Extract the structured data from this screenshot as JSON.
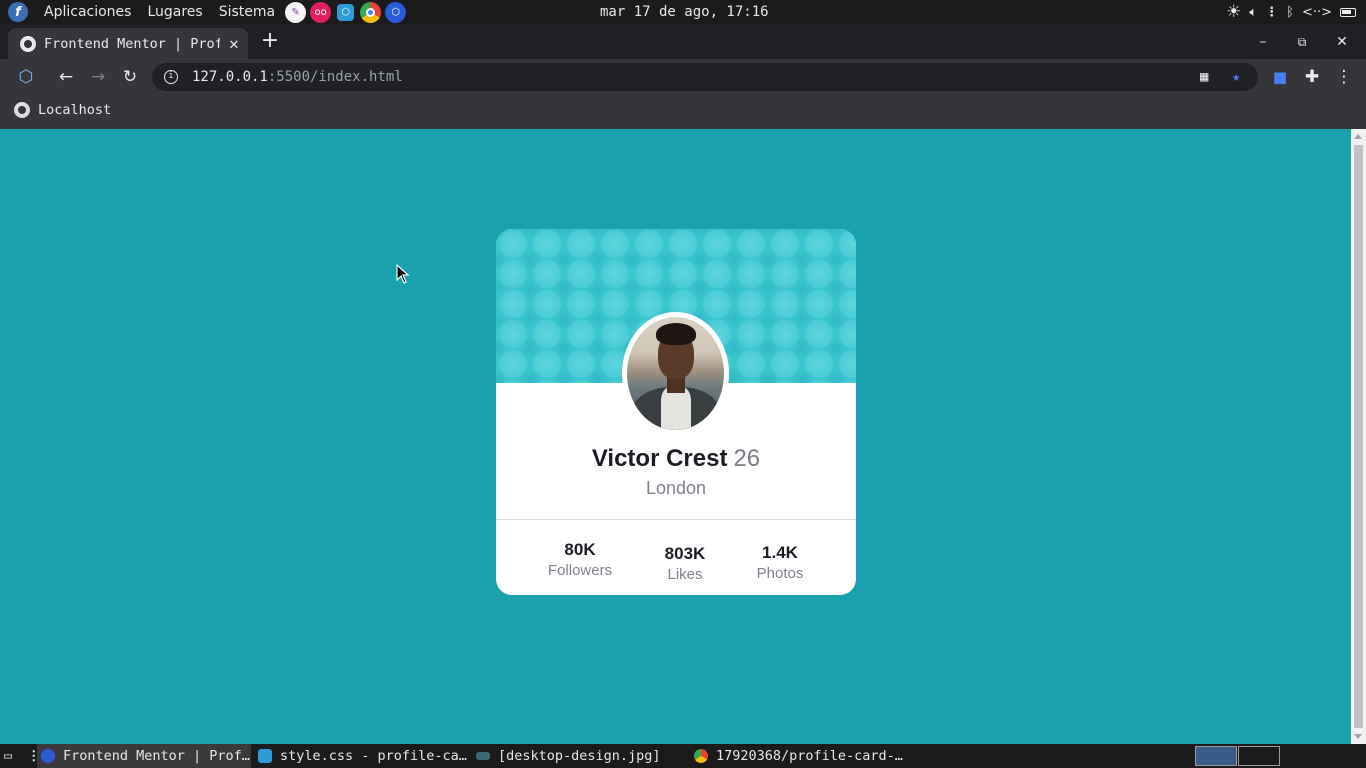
{
  "top_panel": {
    "menus": [
      "Aplicaciones",
      "Lugares",
      "Sistema"
    ],
    "clock": "mar 17 de ago, 17:16"
  },
  "browser": {
    "tab_title": "Frontend Mentor | Prof",
    "url_host": "127.0.0.1",
    "url_rest": ":5500/index.html",
    "bookmark": "Localhost"
  },
  "card": {
    "name": "Victor Crest",
    "age": "26",
    "city": "London",
    "stats": [
      {
        "value": "80K",
        "label": "Followers"
      },
      {
        "value": "803K",
        "label": "Likes"
      },
      {
        "value": "1.4K",
        "label": "Photos"
      }
    ]
  },
  "taskbar": {
    "tasks": [
      "Frontend Mentor | Prof…",
      "style.css - profile-ca…",
      "[desktop-design.jpg]",
      "17920368/profile-card-…"
    ]
  },
  "colors": {
    "page_background": "#19a2ae",
    "card_pattern": "#37c4cf",
    "name_text": "#1b1d26",
    "muted_text": "#7f828e"
  },
  "icons": [
    "fedora-icon",
    "pencil-icon",
    "flickr-icon",
    "vscode-icon",
    "chrome-icon",
    "brave-icon",
    "brightness-icon",
    "volume-icon",
    "bluetooth-icon",
    "network-icon",
    "battery-icon",
    "back-icon",
    "forward-icon",
    "reload-icon",
    "info-icon",
    "qr-icon",
    "star-icon",
    "camera-icon",
    "puzzle-icon",
    "kebab-menu-icon"
  ]
}
